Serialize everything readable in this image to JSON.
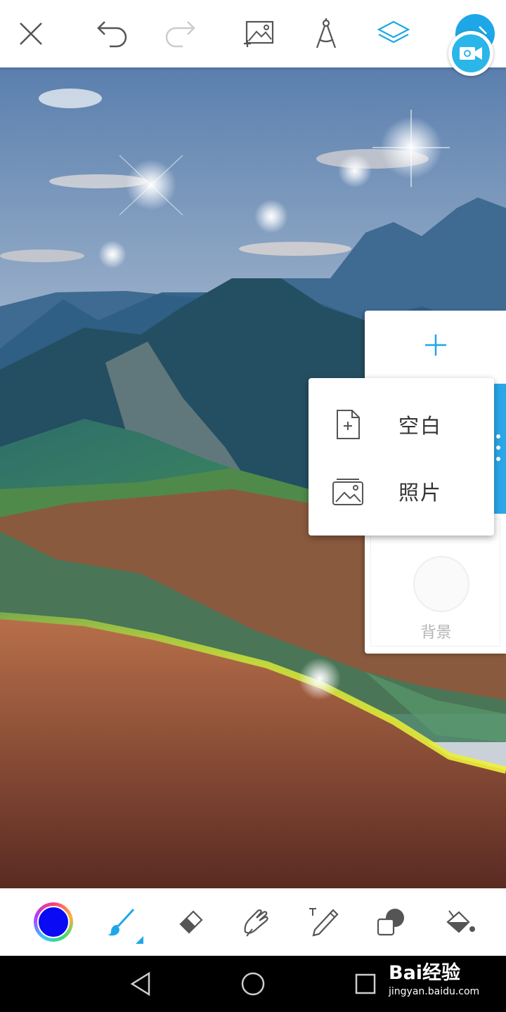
{
  "toolbar": {
    "close": "close-icon",
    "undo": "undo-icon",
    "redo": "redo-icon",
    "add_photo": "add-photo-icon",
    "compass": "compass-icon",
    "layers": "layers-icon",
    "next": "arrow-right-icon",
    "record": "video-camera-icon"
  },
  "layers_panel": {
    "add_icon": "plus-icon",
    "background_label": "背景"
  },
  "add_layer_menu": {
    "items": [
      {
        "label": "空白",
        "icon": "blank-page-icon"
      },
      {
        "label": "照片",
        "icon": "photo-icon"
      }
    ]
  },
  "bottom_tools": {
    "color": "#0a0af5",
    "items": [
      "brush-icon",
      "eraser-icon",
      "smudge-icon",
      "text-icon",
      "shape-icon",
      "fill-bucket-icon"
    ]
  },
  "watermark": {
    "brand": "Bai经验",
    "url": "jingyan.baidu.com"
  },
  "colors": {
    "accent": "#1ea7e8",
    "icon": "#555555"
  }
}
